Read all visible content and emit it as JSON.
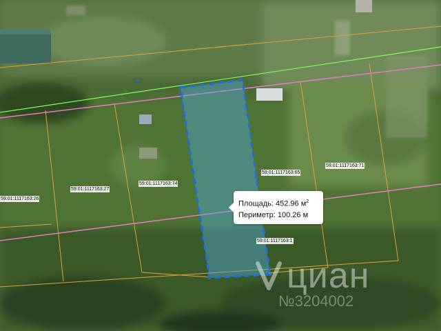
{
  "map": {
    "parcels": [
      {
        "id": "59:01:1117163:26"
      },
      {
        "id": "59:01:1117163:27"
      },
      {
        "id": "59:01:1117163:74"
      },
      {
        "id": "59:01:1117163:65"
      },
      {
        "id": "59:01:1117163:71"
      },
      {
        "id": "59:01:1117163:1"
      }
    ]
  },
  "measurement": {
    "area_label": "Площадь:",
    "area_value": "452.96 м",
    "area_unit_sup": "2",
    "perimeter_label": "Периметр:",
    "perimeter_value": "100.26 м"
  },
  "watermark": {
    "brand": "циан",
    "listing_id": "№3204002"
  },
  "colors": {
    "boundary": "#e0a040",
    "road_green": "#7cff5a",
    "road_pink": "#e879c9",
    "selection_fill": "#4fa8d8",
    "selection_stroke": "#1e6fe0"
  }
}
